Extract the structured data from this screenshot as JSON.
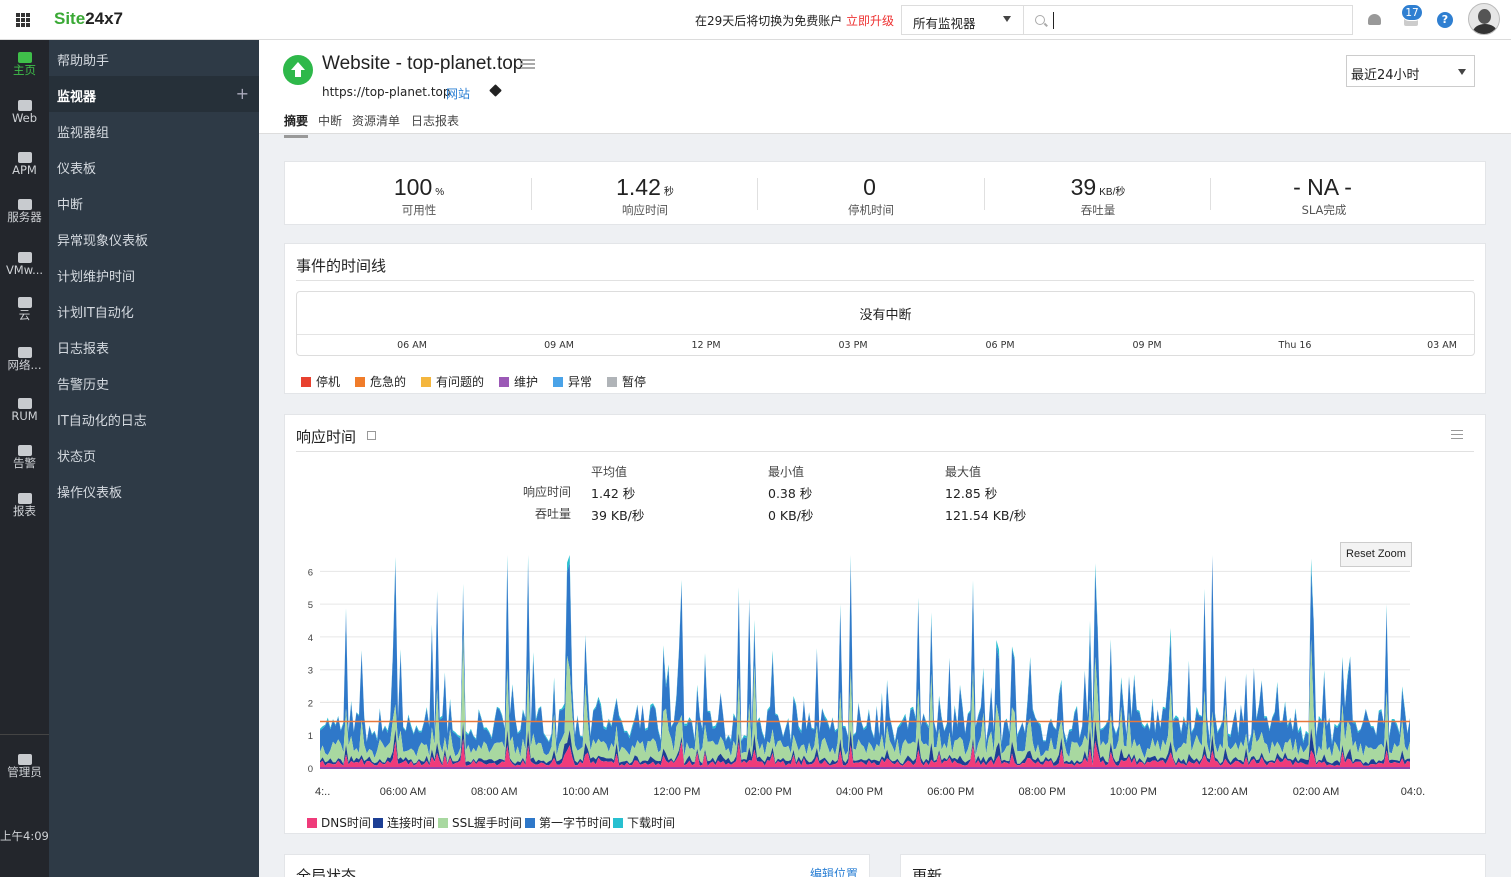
{
  "topbar": {
    "logo_prefix": "Site",
    "logo_suffix": "24x7",
    "trial_text": "在29天后将切换为免费账户",
    "upgrade_label": "立即升级",
    "monitor_filter": "所有监视器",
    "search_placeholder": "",
    "notification_count": "17",
    "help_label": "?"
  },
  "rail": {
    "items": [
      {
        "label": "主页",
        "icon": "home-icon",
        "active": true
      },
      {
        "label": "Web",
        "icon": "web-icon"
      },
      {
        "label": "APM",
        "icon": "apm-icon"
      },
      {
        "label": "服务器",
        "icon": "server-icon"
      },
      {
        "label": "VMw...",
        "icon": "vm-icon"
      },
      {
        "label": "云",
        "icon": "cloud-icon"
      },
      {
        "label": "网络...",
        "icon": "network-icon"
      },
      {
        "label": "RUM",
        "icon": "rum-icon"
      },
      {
        "label": "告警",
        "icon": "alarm-icon"
      },
      {
        "label": "报表",
        "icon": "report-icon"
      }
    ],
    "admin_label": "管理员",
    "time_label": "上午4:09"
  },
  "nav": {
    "items": [
      {
        "label": "帮助助手"
      },
      {
        "label": "监视器",
        "active": true
      },
      {
        "label": "监视器组"
      },
      {
        "label": "仪表板"
      },
      {
        "label": "中断"
      },
      {
        "label": "异常现象仪表板"
      },
      {
        "label": "计划维护时间"
      },
      {
        "label": "计划IT自动化"
      },
      {
        "label": "日志报表"
      },
      {
        "label": "告警历史"
      },
      {
        "label": "IT自动化的日志"
      },
      {
        "label": "状态页"
      },
      {
        "label": "操作仪表板"
      }
    ],
    "add_label": "+"
  },
  "header": {
    "title": "Website - top-planet.top",
    "url": "https://top-planet.top",
    "type": "网站",
    "tabs": [
      "摘要",
      "中断",
      "资源清单",
      "日志报表"
    ],
    "period": "最近24小时"
  },
  "kpis": [
    {
      "value": "100",
      "unit": "%",
      "label": "可用性"
    },
    {
      "value": "1.42",
      "unit": "秒",
      "label": "响应时间"
    },
    {
      "value": "0",
      "unit": "",
      "label": "停机时间"
    },
    {
      "value": "39",
      "unit": "KB/秒",
      "label": "吞吐量"
    },
    {
      "value": "- NA -",
      "unit": "",
      "label": "SLA完成"
    }
  ],
  "events": {
    "title": "事件的时间线",
    "no_outage": "没有中断",
    "ticks": [
      "06 AM",
      "09 AM",
      "12 PM",
      "03 PM",
      "06 PM",
      "09 PM",
      "Thu 16",
      "03 AM"
    ],
    "legend": [
      {
        "label": "停机",
        "color": "#e8412f"
      },
      {
        "label": "危急的",
        "color": "#f07c2a"
      },
      {
        "label": "有问题的",
        "color": "#f4b63e"
      },
      {
        "label": "维护",
        "color": "#9b59b6"
      },
      {
        "label": "异常",
        "color": "#4aa3e8"
      },
      {
        "label": "暂停",
        "color": "#b0b4b8"
      }
    ]
  },
  "response": {
    "title": "响应时间",
    "stats": {
      "headers": [
        "平均值",
        "最小值",
        "最大值"
      ],
      "rows": [
        {
          "label": "响应时间",
          "avg": "1.42 秒",
          "min": "0.38 秒",
          "max": "12.85 秒"
        },
        {
          "label": "吞吐量",
          "avg": "39 KB/秒",
          "min": "0 KB/秒",
          "max": "121.54 KB/秒"
        }
      ]
    },
    "reset_zoom": "Reset Zoom",
    "legend": [
      {
        "label": "DNS时间",
        "color": "#ef3b7a"
      },
      {
        "label": "连接时间",
        "color": "#1c3f95"
      },
      {
        "label": "SSL握手时间",
        "color": "#a8d8a0"
      },
      {
        "label": "第一字节时间",
        "color": "#2f78c9"
      },
      {
        "label": "下载时间",
        "color": "#28c0d0"
      }
    ]
  },
  "chart_data": {
    "type": "area",
    "title": "",
    "xlabel": "",
    "ylabel": "",
    "ylim": [
      0,
      6.5
    ],
    "yticks": [
      0,
      1,
      2,
      3,
      4,
      5,
      6
    ],
    "x_ticks": [
      "4:..",
      "06:00 AM",
      "08:00 AM",
      "10:00 AM",
      "12:00 PM",
      "02:00 PM",
      "04:00 PM",
      "06:00 PM",
      "08:00 PM",
      "10:00 PM",
      "12:00 AM",
      "02:00 AM",
      "04:0."
    ],
    "average_line": 1.42,
    "average_color": "#e8783c",
    "grid": true,
    "legend_position": "bottom",
    "stacked": true,
    "series": [
      {
        "name": "DNS时间",
        "color": "#ef3b7a",
        "typical": 0.15
      },
      {
        "name": "连接时间",
        "color": "#1c3f95",
        "typical": 0.1
      },
      {
        "name": "SSL握手时间",
        "color": "#a8d8a0",
        "typical": 0.4
      },
      {
        "name": "第一字节时间",
        "color": "#2f78c9",
        "typical": 0.7
      },
      {
        "name": "下载时间",
        "color": "#28c0d0",
        "typical": 0.05
      }
    ],
    "peaks": [
      {
        "x": "10:00 AM",
        "y": 6.5
      },
      {
        "x": "11:00 AM",
        "y": 6.5
      },
      {
        "x": "11:30 AM",
        "y": 6.5
      },
      {
        "x": "10:00 PM",
        "y": 6.5
      },
      {
        "x": "06:00 AM",
        "y": 5.0
      },
      {
        "x": "08:00 AM",
        "y": 5.2
      },
      {
        "x": "12:30 AM",
        "y": 5.0
      }
    ]
  },
  "bottom": {
    "global_status": "全局状态",
    "edit_location": "编辑位置",
    "updates": "更新"
  }
}
